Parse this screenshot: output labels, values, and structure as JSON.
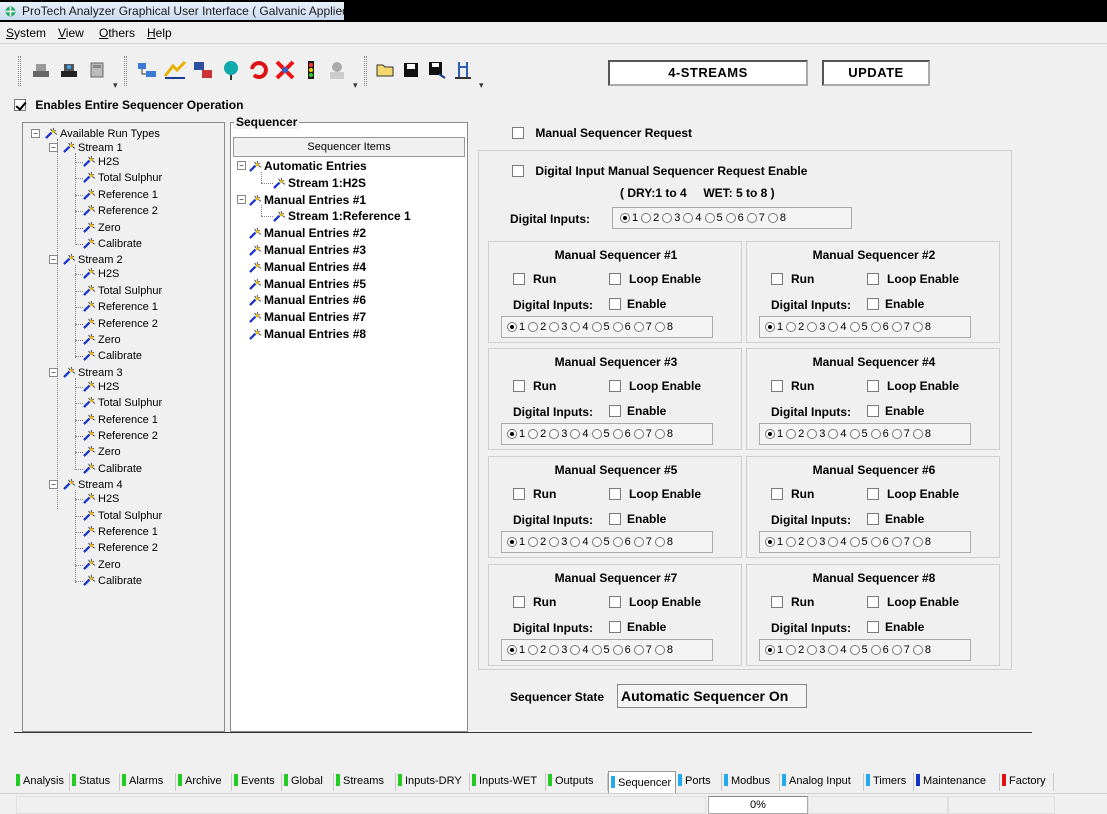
{
  "window": {
    "title": "ProTech Analyzer Graphical User Interface  ( Galvanic Applied Sciences, Inc. )"
  },
  "menu": [
    {
      "label": "System",
      "underline": "S",
      "rest": "ystem"
    },
    {
      "label": "View",
      "underline": "V",
      "rest": "iew"
    },
    {
      "label": "Others",
      "underline": "O",
      "rest": "thers"
    },
    {
      "label": "Help",
      "underline": "H",
      "rest": "elp"
    }
  ],
  "toolbar": {
    "stream_count": "4-STREAMS",
    "update_label": "UPDATE"
  },
  "enable_sequencer": {
    "label": "Enables Entire Sequencer Operation",
    "checked": true
  },
  "run_types_tree": {
    "root": "Available Run Types",
    "streams": [
      {
        "name": "Stream 1",
        "items": [
          "H2S",
          "Total Sulphur",
          "Reference 1",
          "Reference 2",
          "Zero",
          "Calibrate"
        ]
      },
      {
        "name": "Stream 2",
        "items": [
          "H2S",
          "Total Sulphur",
          "Reference 1",
          "Reference 2",
          "Zero",
          "Calibrate"
        ]
      },
      {
        "name": "Stream 3",
        "items": [
          "H2S",
          "Total Sulphur",
          "Reference 1",
          "Reference 2",
          "Zero",
          "Calibrate"
        ]
      },
      {
        "name": "Stream 4",
        "items": [
          "H2S",
          "Total Sulphur",
          "Reference 1",
          "Reference 2",
          "Zero",
          "Calibrate"
        ]
      }
    ]
  },
  "sequencer": {
    "group_label": "Sequencer",
    "header": "Sequencer Items",
    "entries": [
      {
        "label": "Automatic Entries",
        "children": [
          "Stream 1:H2S"
        ]
      },
      {
        "label": "Manual Entries #1",
        "children": [
          "Stream 1:Reference 1"
        ]
      },
      {
        "label": "Manual Entries #2",
        "children": []
      },
      {
        "label": "Manual Entries #3",
        "children": []
      },
      {
        "label": "Manual Entries #4",
        "children": []
      },
      {
        "label": "Manual Entries #5",
        "children": []
      },
      {
        "label": "Manual Entries #6",
        "children": []
      },
      {
        "label": "Manual Entries #7",
        "children": []
      },
      {
        "label": "Manual Entries #8",
        "children": []
      }
    ]
  },
  "manual_request": {
    "label": "Manual Sequencer Request",
    "di_enable_label": "Digital Input Manual Sequencer Request Enable",
    "dry_wet_note": "( DRY:1 to 4     WET: 5 to 8 )",
    "di_label": "Digital Inputs:",
    "options": [
      "1",
      "2",
      "3",
      "4",
      "5",
      "6",
      "7",
      "8"
    ],
    "selected": "1"
  },
  "manual_sequencers": [
    {
      "title": "Manual Sequencer #1",
      "run": "Run",
      "loop": "Loop Enable",
      "di": "Digital Inputs:",
      "enable": "Enable",
      "selected": "1"
    },
    {
      "title": "Manual Sequencer #2",
      "run": "Run",
      "loop": "Loop Enable",
      "di": "Digital Inputs:",
      "enable": "Enable",
      "selected": "1"
    },
    {
      "title": "Manual Sequencer #3",
      "run": "Run",
      "loop": "Loop Enable",
      "di": "Digital Inputs:",
      "enable": "Enable",
      "selected": "1"
    },
    {
      "title": "Manual Sequencer #4",
      "run": "Run",
      "loop": "Loop Enable",
      "di": "Digital Inputs:",
      "enable": "Enable",
      "selected": "1"
    },
    {
      "title": "Manual Sequencer #5",
      "run": "Run",
      "loop": "Loop Enable",
      "di": "Digital Inputs:",
      "enable": "Enable",
      "selected": "1"
    },
    {
      "title": "Manual Sequencer #6",
      "run": "Run",
      "loop": "Loop Enable",
      "di": "Digital Inputs:",
      "enable": "Enable",
      "selected": "1"
    },
    {
      "title": "Manual Sequencer #7",
      "run": "Run",
      "loop": "Loop Enable",
      "di": "Digital Inputs:",
      "enable": "Enable",
      "selected": "1"
    },
    {
      "title": "Manual Sequencer #8",
      "run": "Run",
      "loop": "Loop Enable",
      "di": "Digital Inputs:",
      "enable": "Enable",
      "selected": "1"
    }
  ],
  "sequencer_state": {
    "label": "Sequencer State",
    "value": "Automatic Sequencer On"
  },
  "tabs": [
    {
      "label": "Analysis",
      "color": "#22cc22"
    },
    {
      "label": "Status",
      "color": "#22cc22"
    },
    {
      "label": "Alarms",
      "color": "#22cc22"
    },
    {
      "label": "Archive",
      "color": "#22cc22"
    },
    {
      "label": "Events",
      "color": "#22cc22"
    },
    {
      "label": "Global",
      "color": "#22cc22"
    },
    {
      "label": "Streams",
      "color": "#22cc22"
    },
    {
      "label": "Inputs-DRY",
      "color": "#22cc22"
    },
    {
      "label": "Inputs-WET",
      "color": "#22cc22"
    },
    {
      "label": "Outputs",
      "color": "#22cc22"
    },
    {
      "label": "Sequencer",
      "color": "#22aaee",
      "active": true
    },
    {
      "label": "Ports",
      "color": "#22aaee"
    },
    {
      "label": "Modbus",
      "color": "#22aaee"
    },
    {
      "label": "Analog Input",
      "color": "#22aaee"
    },
    {
      "label": "Timers",
      "color": "#22aaee"
    },
    {
      "label": "Maintenance",
      "color": "#1133cc"
    },
    {
      "label": "Factory",
      "color": "#dd1111"
    }
  ],
  "status": {
    "progress": "0%"
  }
}
